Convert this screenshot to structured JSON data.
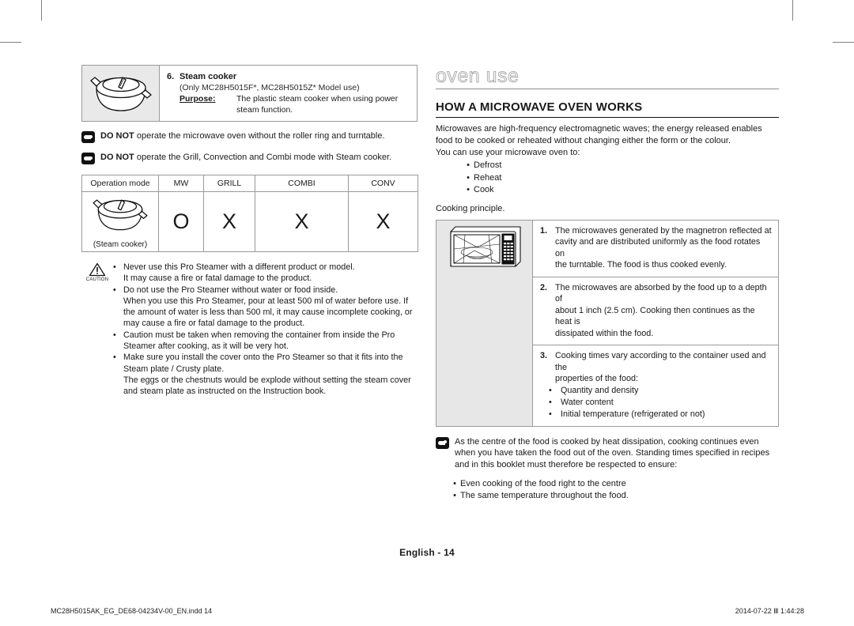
{
  "left": {
    "item": {
      "number": "6.",
      "title": "Steam cooker",
      "model_note": "(Only MC28H5015F*, MC28H5015Z* Model use)",
      "purpose_label": "Purpose:",
      "purpose_text": "The plastic steam cooker when using power",
      "purpose_cont": "steam function.",
      "icon": "steam-cooker-illustration"
    },
    "notes": [
      {
        "bold": "DO NOT",
        "rest": " operate the microwave oven without the roller ring and turntable."
      },
      {
        "bold": "DO NOT",
        "rest": " operate the Grill, Convection and Combi mode with Steam cooker."
      }
    ],
    "table": {
      "headers": [
        "Operation mode",
        "MW",
        "GRILL",
        "COMBI",
        "CONV"
      ],
      "row_caption": "(Steam cooker)",
      "values": [
        "O",
        "X",
        "X",
        "X"
      ]
    },
    "caution": {
      "label": "CAUTION",
      "items": [
        {
          "lines": [
            "Never use this Pro Steamer with a different product or model.",
            "It may cause a fire or fatal damage to the product."
          ]
        },
        {
          "lines": [
            "Do not use the Pro Steamer without water or food inside.",
            "When you use this Pro Steamer, pour at least 500 ml of water before use. If",
            "the amount of water is less than 500 ml, it may cause incomplete cooking, or",
            "may cause a fire or fatal damage to the product."
          ]
        },
        {
          "lines": [
            "Caution must be taken when removing the container from inside the Pro",
            "Steamer after cooking, as it will be very hot."
          ]
        },
        {
          "lines": [
            "Make sure you install the cover onto the Pro Steamer so that it fits into the",
            "Steam plate / Crusty plate.",
            "The eggs or the chestnuts would be explode without setting the steam cover",
            "and steam plate as instructed on the Instruction book."
          ]
        }
      ]
    }
  },
  "right": {
    "chapter_title": "oven use",
    "section_title": "HOW A MICROWAVE OVEN WORKS",
    "intro": [
      "Microwaves are high-frequency electromagnetic waves; the energy released enables",
      "food to be cooked or reheated without changing either the form or the colour.",
      "You can use your microwave oven to:"
    ],
    "uses": [
      "Defrost",
      "Reheat",
      "Cook"
    ],
    "cooking_principle_label": "Cooking principle.",
    "principle_image": "microwave-oven-illustration",
    "principles": [
      {
        "num": "1.",
        "lines": [
          "The microwaves generated by the magnetron reflected at",
          "cavity and are distributed uniformly as the food rotates on",
          "the turntable. The food is thus cooked evenly."
        ],
        "subs": []
      },
      {
        "num": "2.",
        "lines": [
          "The microwaves are absorbed by the food up to a depth of",
          "about 1 inch (2.5 cm). Cooking then continues as the heat is",
          "dissipated within the food."
        ],
        "subs": []
      },
      {
        "num": "3.",
        "lines": [
          "Cooking times vary according to the container used and the",
          "properties of the food:"
        ],
        "subs": [
          "Quantity and density",
          "Water content",
          "Initial temperature (refrigerated or not)"
        ]
      }
    ],
    "final_note": [
      "As the centre of the food is cooked by heat dissipation, cooking continues even",
      "when you have taken the food out of the oven. Standing times specified in recipes",
      "and in this booklet must therefore be respected to ensure:"
    ],
    "final_dots": [
      "Even cooking of the food right to the centre",
      "The same temperature throughout the food."
    ]
  },
  "footer": {
    "page_label": "English - 14",
    "file_name": "MC28H5015AK_EG_DE68-04234V-00_EN.indd   14",
    "timestamp": "2014-07-22   Ⅲ 1:44:28"
  },
  "colors": {
    "rule": "#8e8e8e",
    "cell_bg": "#e9e9e9",
    "title_outline": "#9a9a9a",
    "text": "#1a1a1a"
  }
}
